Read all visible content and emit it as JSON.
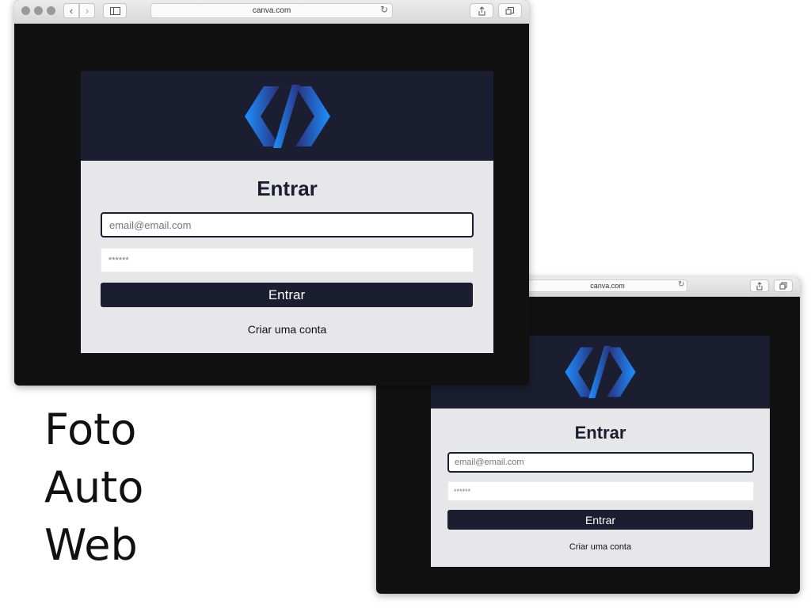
{
  "front_window": {
    "url": "canva.com",
    "card": {
      "title": "Entrar",
      "email_placeholder": "email@email.com",
      "password_placeholder": "******",
      "submit_label": "Entrar",
      "create_account_link": "Criar uma conta"
    }
  },
  "back_window": {
    "url": "canva.com",
    "card": {
      "title": "Entrar",
      "email_placeholder": "email@email.com",
      "password_placeholder": "******",
      "submit_label": "Entrar",
      "create_account_link": "Criar uma conta"
    }
  },
  "caption": {
    "line1": "Foto",
    "line2": "Auto",
    "line3": "Web"
  },
  "colors": {
    "page_background": "#111111",
    "card_header": "#1b1d30",
    "card_body": "#e7e7ea",
    "logo_gradient_start": "#1e90ff",
    "logo_gradient_end": "#2a2f7a"
  },
  "icons": [
    "back-arrow-icon",
    "forward-arrow-icon",
    "sidebar-icon",
    "reload-icon",
    "share-icon",
    "tabs-icon",
    "code-logo-icon"
  ]
}
